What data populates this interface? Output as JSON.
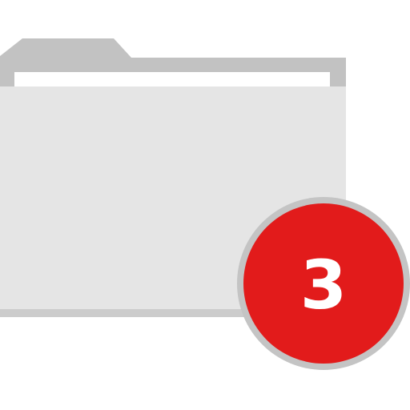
{
  "folder": {
    "icon": "folder-icon",
    "colors": {
      "tab": "#c2c2c2",
      "paper": "#ffffff",
      "front": "#e5e5e5",
      "bottom_edge": "#cccccc"
    }
  },
  "badge": {
    "icon": "notification-badge",
    "count": "3",
    "colors": {
      "fill": "#e21b1b",
      "ring": "#c4c4c4",
      "text": "#ffffff"
    }
  }
}
